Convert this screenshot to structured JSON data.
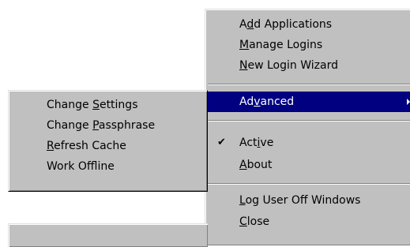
{
  "main_menu": {
    "items": [
      {
        "pre": "A",
        "key": "d",
        "post": "d Applications"
      },
      {
        "pre": "",
        "key": "M",
        "post": "anage Logins"
      },
      {
        "pre": "",
        "key": "N",
        "post": "ew Login Wizard"
      },
      {
        "pre": "Ad",
        "key": "v",
        "post": "anced"
      },
      {
        "pre": "Act",
        "key": "i",
        "post": "ve"
      },
      {
        "pre": "",
        "key": "A",
        "post": "bout"
      },
      {
        "pre": "",
        "key": "L",
        "post": "og User Off Windows"
      },
      {
        "pre": "",
        "key": "C",
        "post": "lose"
      }
    ],
    "checkmark": "✔"
  },
  "advanced_submenu": {
    "items": [
      {
        "pre": "Change ",
        "key": "S",
        "post": "ettings"
      },
      {
        "pre": "Change ",
        "key": "P",
        "post": "assphrase"
      },
      {
        "pre": "",
        "key": "R",
        "post": "efresh Cache"
      },
      {
        "pre": "Work Offline",
        "key": "",
        "post": ""
      }
    ]
  },
  "colors": {
    "menu_face": "#c0c0c0",
    "highlight": "#000080",
    "highlight_text": "#ffffff"
  }
}
